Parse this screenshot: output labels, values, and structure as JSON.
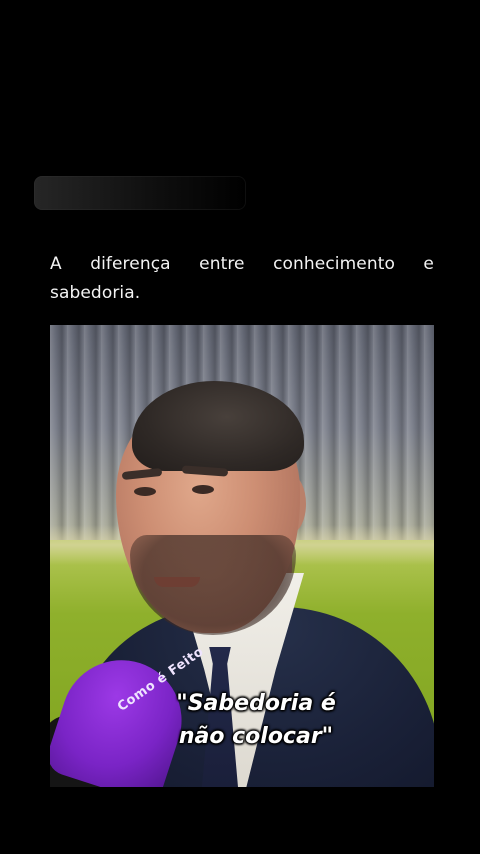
{
  "post": {
    "caption": "A diferença entre conhecimento e sabedoria."
  },
  "video": {
    "subtitle_line1": "\"Sabedoria é",
    "subtitle_line2": "não colocar\"",
    "mic_brand": "Como é Feito"
  }
}
